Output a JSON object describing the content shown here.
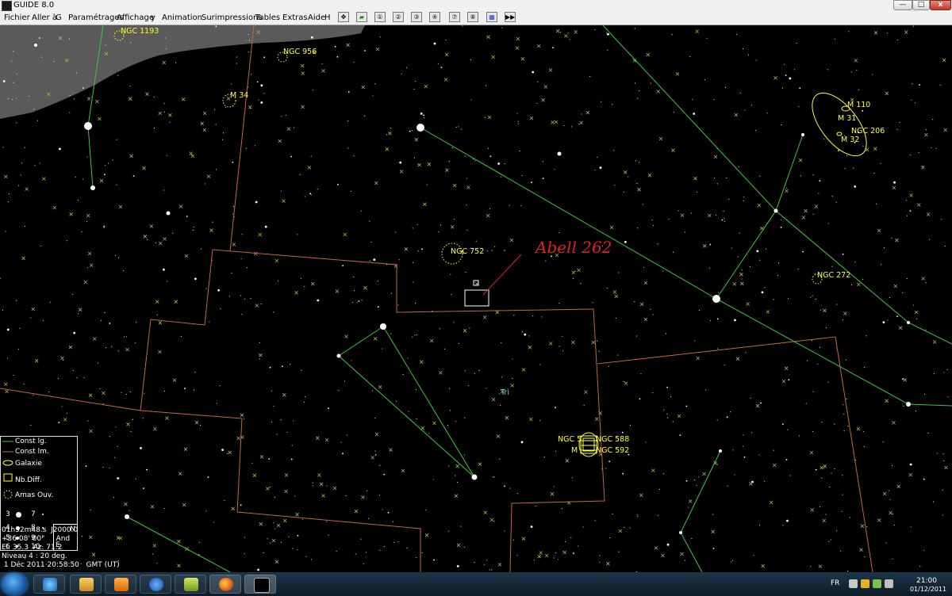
{
  "window": {
    "title": "GUIDE 8.0",
    "min_label": "—",
    "max_label": "□",
    "close_label": "x"
  },
  "menu": [
    {
      "name": "menu-fichier",
      "label": "Fichier"
    },
    {
      "name": "menu-aller-a",
      "label": "Aller à"
    },
    {
      "name": "menu-g",
      "label": "G"
    },
    {
      "name": "menu-parametrages",
      "label": "Paramétrages"
    },
    {
      "name": "menu-affichage",
      "label": "Affichage"
    },
    {
      "name": "menu-y",
      "label": "y"
    },
    {
      "name": "menu-animation",
      "label": "Animation"
    },
    {
      "name": "menu-surimpressions",
      "label": "Surimpressions"
    },
    {
      "name": "menu-tables",
      "label": "Tables"
    },
    {
      "name": "menu-extras",
      "label": "Extras"
    },
    {
      "name": "menu-aide",
      "label": "Aide"
    },
    {
      "name": "menu-h",
      "label": "H"
    }
  ],
  "toolbar": [
    {
      "name": "toolbar-nav-icon",
      "glyph": "✥"
    },
    {
      "name": "toolbar-eraser-icon",
      "glyph": "▰"
    },
    {
      "name": "toolbar-zoom-1-icon",
      "glyph": "①"
    },
    {
      "name": "toolbar-zoom-2-icon",
      "glyph": "②"
    },
    {
      "name": "toolbar-zoom-3-icon",
      "glyph": "③"
    },
    {
      "name": "toolbar-zoom-4-icon",
      "glyph": "④"
    },
    {
      "name": "toolbar-zoom-7-icon",
      "glyph": "⑦"
    },
    {
      "name": "toolbar-zoom-8-icon",
      "glyph": "⑧"
    },
    {
      "name": "toolbar-grid-icon",
      "glyph": "▦"
    },
    {
      "name": "toolbar-play-icon",
      "glyph": "▶▶"
    }
  ],
  "objects": {
    "ngc1193": "NGC 1193",
    "ngc956": "NGC 956",
    "m34": "M 34",
    "m110": "M 110",
    "m31": "M 31",
    "ngc206": "NGC 206",
    "m32": "M 32",
    "ngc752": "NGC 752",
    "ngc272": "NGC 272",
    "tri": "Tri",
    "ngc_left": "NGC 5",
    "ngc588": "NGC 588",
    "m_left": "M",
    "ngc592": "NGC 592"
  },
  "annotation": {
    "text": "Abell 262",
    "color": "#e21f1f"
  },
  "legend": {
    "const_lg": "Const lg.",
    "const_lm": "Const lm.",
    "galaxie": "Galaxie",
    "nb_diff": "Nb.Diff.",
    "amas_ouv": "Amas Ouv.",
    "mags": [
      "3",
      "7",
      "4",
      "8",
      "5",
      "9",
      "6",
      "10"
    ],
    "compass_n": "N",
    "compass_e": "E"
  },
  "status": {
    "ra": "01h52m48.s  J2000.0",
    "dec": "+36 08' 00\"     And",
    "elaz": "El. 35.3  Az. 71.2",
    "level": "Niveau 4 : 20 deg.",
    "datetime": " 1 Déc 2011 20:58:50   GMT (UT)"
  },
  "tray": {
    "lang": "FR",
    "time": "21:00",
    "date": "01/12/2011"
  },
  "colors": {
    "constellation_lines": "#3cc83c",
    "constellation_boundaries": "#c8643c",
    "object_labels": "#ffff33",
    "annotation": "#e21f1f",
    "milky_way": "#5a5a5a"
  }
}
